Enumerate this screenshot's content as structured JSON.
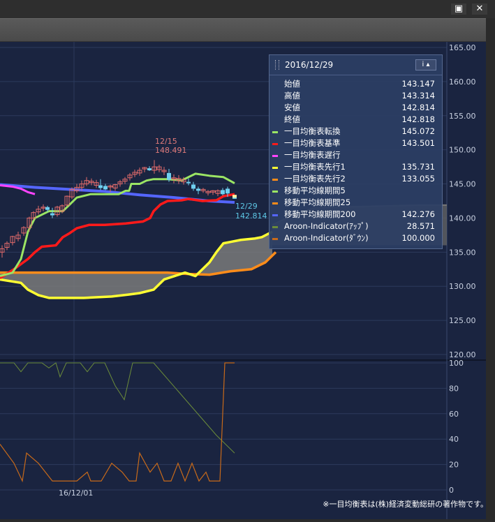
{
  "window": {
    "restore_label": "▣",
    "close_label": "✕"
  },
  "info_panel": {
    "date": "2016/12/29",
    "info_button_label": "i ▴",
    "rows": [
      {
        "label": "始値",
        "value": "143.147",
        "color": ""
      },
      {
        "label": "高値",
        "value": "143.314",
        "color": ""
      },
      {
        "label": "安値",
        "value": "142.814",
        "color": ""
      },
      {
        "label": "終値",
        "value": "142.818",
        "color": ""
      },
      {
        "label": "一目均衡表転換",
        "value": "145.072",
        "color": "#9be564"
      },
      {
        "label": "一目均衡表基準",
        "value": "143.501",
        "color": "#ff1a1a"
      },
      {
        "label": "一目均衡表遅行",
        "value": "",
        "color": "#ff44ff"
      },
      {
        "label": "一目均衡表先行1",
        "value": "135.731",
        "color": "#ffff33"
      },
      {
        "label": "一目均衡表先行2",
        "value": "133.055",
        "color": "#ff8c1a"
      },
      {
        "label": "移動平均線期間5",
        "value": "",
        "color": "#9be564"
      },
      {
        "label": "移動平均線期間25",
        "value": "",
        "color": "#ff8c1a"
      },
      {
        "label": "移動平均線期間200",
        "value": "142.276",
        "color": "#5566ff"
      },
      {
        "label": "Aroon-Indicator(ｱｯﾌﾟ)",
        "value": "28.571",
        "color": "#6b8c3a"
      },
      {
        "label": "Aroon-Indicator(ﾀﾞｳﾝ)",
        "value": "100.000",
        "color": "#c86a1a"
      }
    ]
  },
  "annotations": {
    "high_date": "12/15",
    "high_value": "148.491",
    "low_date": "12/29",
    "low_value": "142.814"
  },
  "copyright": "※一目均衡表は(株)経済変動総研の著作物です。",
  "chart_data": {
    "type": "line",
    "main": {
      "y_ticks": [
        "165.00",
        "160.00",
        "155.00",
        "150.00",
        "145.00",
        "140.00",
        "135.00",
        "130.00",
        "125.00",
        "120.00"
      ],
      "ylim": [
        120,
        165
      ]
    },
    "aroon": {
      "y_ticks": [
        "100",
        "80",
        "60",
        "40",
        "20",
        "0"
      ],
      "ylim": [
        0,
        100
      ],
      "x_label": "16/12/01"
    },
    "series": [
      {
        "name": "一目均衡表転換",
        "color": "#9be564",
        "width": 3,
        "values": [
          [
            0,
            131.5
          ],
          [
            18,
            132
          ],
          [
            30,
            134
          ],
          [
            40,
            138
          ],
          [
            50,
            140
          ],
          [
            60,
            140.5
          ],
          [
            70,
            141
          ],
          [
            90,
            141
          ],
          [
            100,
            142
          ],
          [
            110,
            143
          ],
          [
            130,
            143.5
          ],
          [
            150,
            143.5
          ],
          [
            170,
            143.5
          ],
          [
            180,
            144
          ],
          [
            185,
            144
          ],
          [
            188,
            145
          ],
          [
            200,
            145
          ],
          [
            210,
            145.5
          ],
          [
            220,
            145.7
          ],
          [
            240,
            145.7
          ],
          [
            260,
            145.5
          ],
          [
            270,
            146
          ],
          [
            280,
            146.5
          ],
          [
            300,
            146.2
          ],
          [
            320,
            146
          ],
          [
            336,
            145.1
          ]
        ]
      },
      {
        "name": "一目均衡表基準",
        "color": "#ff1a1a",
        "width": 3.5,
        "values": [
          [
            0,
            131.2
          ],
          [
            20,
            132.5
          ],
          [
            40,
            134
          ],
          [
            50,
            135
          ],
          [
            60,
            135.8
          ],
          [
            80,
            136
          ],
          [
            90,
            137.2
          ],
          [
            100,
            137.8
          ],
          [
            110,
            138.5
          ],
          [
            128,
            139
          ],
          [
            150,
            139
          ],
          [
            180,
            139.2
          ],
          [
            205,
            139.5
          ],
          [
            215,
            140
          ],
          [
            220,
            141
          ],
          [
            230,
            142
          ],
          [
            240,
            142.5
          ],
          [
            260,
            142.6
          ],
          [
            270,
            142.8
          ],
          [
            290,
            142.5
          ],
          [
            310,
            142.6
          ],
          [
            320,
            143.2
          ],
          [
            336,
            143.5
          ]
        ]
      },
      {
        "name": "一目均衡表遅行",
        "color": "#ff44ff",
        "width": 3,
        "values": [
          [
            0,
            144.8
          ],
          [
            18,
            144.6
          ],
          [
            30,
            144.3
          ],
          [
            40,
            143.8
          ],
          [
            50,
            143.5
          ]
        ]
      },
      {
        "name": "一目均衡表先行1",
        "color": "#ffff33",
        "width": 3.5,
        "values": [
          [
            0,
            131
          ],
          [
            30,
            130.5
          ],
          [
            40,
            129.5
          ],
          [
            55,
            128.7
          ],
          [
            70,
            128.3
          ],
          [
            90,
            128.3
          ],
          [
            120,
            128.3
          ],
          [
            160,
            128.5
          ],
          [
            185,
            128.8
          ],
          [
            200,
            129
          ],
          [
            220,
            129.5
          ],
          [
            235,
            131
          ],
          [
            250,
            131.5
          ],
          [
            265,
            132
          ],
          [
            280,
            131.5
          ],
          [
            300,
            133.5
          ],
          [
            310,
            135
          ],
          [
            320,
            136.3
          ],
          [
            330,
            136.5
          ],
          [
            345,
            136.8
          ],
          [
            365,
            137
          ],
          [
            375,
            137.2
          ],
          [
            390,
            138
          ]
        ]
      },
      {
        "name": "一目均衡表先行2",
        "color": "#ff8c1a",
        "width": 3.5,
        "values": [
          [
            0,
            132
          ],
          [
            60,
            132
          ],
          [
            100,
            132
          ],
          [
            150,
            132
          ],
          [
            200,
            132
          ],
          [
            240,
            132
          ],
          [
            270,
            131.8
          ],
          [
            300,
            131.7
          ],
          [
            330,
            132.2
          ],
          [
            360,
            132.5
          ],
          [
            380,
            133.5
          ],
          [
            395,
            135
          ]
        ]
      },
      {
        "name": "移動平均線期間200",
        "color": "#5566ff",
        "width": 4,
        "values": [
          [
            0,
            144.9
          ],
          [
            50,
            144.5
          ],
          [
            100,
            144.2
          ],
          [
            150,
            143.9
          ],
          [
            200,
            143.4
          ],
          [
            250,
            143
          ],
          [
            300,
            142.5
          ],
          [
            336,
            142.3
          ]
        ]
      }
    ],
    "cloud_right": [
      [
        390,
        139
      ],
      [
        420,
        140.5
      ],
      [
        450,
        141.5
      ],
      [
        480,
        141.6
      ],
      [
        520,
        141.7
      ],
      [
        560,
        141.8
      ],
      [
        600,
        141.9
      ],
      [
        640,
        141.9
      ]
    ],
    "candles": [
      [
        3,
        135.0,
        136.0,
        134.2,
        135.5
      ],
      [
        10,
        135.7,
        136.6,
        135.3,
        136.3
      ],
      [
        18,
        136.4,
        137.4,
        136.0,
        137.3
      ],
      [
        26,
        137.0,
        138.0,
        136.6,
        137.5
      ],
      [
        34,
        137.8,
        138.8,
        137.4,
        138.6
      ],
      [
        42,
        138.6,
        140.2,
        138.0,
        140.0
      ],
      [
        48,
        140.0,
        141.0,
        139.7,
        140.8
      ],
      [
        55,
        140.9,
        141.8,
        140.5,
        141.3
      ],
      [
        62,
        141.5,
        142.0,
        141.0,
        141.6
      ],
      [
        68,
        141.6,
        141.8,
        140.9,
        141.2
      ],
      [
        75,
        140.7,
        141.5,
        140.0,
        140.4
      ],
      [
        82,
        140.5,
        141.8,
        140.2,
        141.6
      ],
      [
        89,
        141.0,
        142.0,
        140.7,
        141.8
      ],
      [
        96,
        141.9,
        143.3,
        141.7,
        143.2
      ],
      [
        103,
        143.1,
        144.5,
        142.8,
        144.2
      ],
      [
        110,
        144.0,
        145.0,
        143.7,
        144.5
      ],
      [
        117,
        144.5,
        145.5,
        144.0,
        145.0
      ],
      [
        124,
        145.0,
        146.0,
        144.7,
        145.5
      ],
      [
        131,
        145.2,
        145.8,
        144.8,
        145.4
      ],
      [
        138,
        144.8,
        145.6,
        144.4,
        145.2
      ],
      [
        144,
        144.8,
        145.7,
        144.1,
        144.4
      ],
      [
        151,
        144.7,
        145.0,
        144.1,
        144.2
      ],
      [
        158,
        144.6,
        144.9,
        143.8,
        144.7
      ],
      [
        165,
        144.4,
        145.0,
        144.0,
        144.9
      ],
      [
        172,
        145.0,
        145.6,
        144.6,
        145.3
      ],
      [
        179,
        145.4,
        146.0,
        145.0,
        145.7
      ],
      [
        186,
        145.9,
        146.6,
        145.5,
        146.3
      ],
      [
        193,
        146.4,
        147.1,
        146.0,
        146.7
      ],
      [
        200,
        146.6,
        147.4,
        146.2,
        147.0
      ],
      [
        207,
        147.2,
        147.5,
        146.7,
        147.4
      ],
      [
        214,
        147.3,
        147.6,
        146.9,
        147.0
      ],
      [
        221,
        147.0,
        148.491,
        146.5,
        147.5
      ],
      [
        228,
        147.1,
        147.8,
        146.7,
        147.5
      ],
      [
        235,
        146.8,
        147.5,
        146.3,
        147.0
      ],
      [
        242,
        146.6,
        147.2,
        145.3,
        145.6
      ],
      [
        249,
        145.7,
        146.4,
        145.1,
        145.9
      ],
      [
        256,
        145.5,
        146.3,
        145.0,
        145.8
      ],
      [
        263,
        145.3,
        146.0,
        144.9,
        145.6
      ],
      [
        270,
        145.3,
        145.8,
        144.8,
        145.1
      ],
      [
        277,
        144.9,
        145.3,
        144.0,
        144.3
      ],
      [
        284,
        144.3,
        144.6,
        143.5,
        144.0
      ],
      [
        291,
        144.0,
        144.4,
        143.7,
        144.2
      ],
      [
        298,
        143.7,
        144.1,
        143.3,
        143.9
      ],
      [
        305,
        143.8,
        144.1,
        143.4,
        144.0
      ],
      [
        312,
        143.6,
        144.2,
        143.2,
        144.0
      ],
      [
        319,
        144.1,
        144.4,
        143.3,
        143.5
      ],
      [
        326,
        144.3,
        144.6,
        143.1,
        143.6
      ],
      [
        336,
        143.147,
        143.314,
        142.814,
        142.818
      ]
    ],
    "aroon_up": [
      [
        0,
        100
      ],
      [
        20,
        100
      ],
      [
        30,
        93
      ],
      [
        40,
        100
      ],
      [
        60,
        100
      ],
      [
        70,
        96
      ],
      [
        80,
        100
      ],
      [
        86,
        89
      ],
      [
        95,
        100
      ],
      [
        115,
        100
      ],
      [
        125,
        93
      ],
      [
        135,
        100
      ],
      [
        150,
        100
      ],
      [
        165,
        82
      ],
      [
        178,
        71
      ],
      [
        190,
        100
      ],
      [
        220,
        100
      ],
      [
        310,
        43
      ],
      [
        336,
        29
      ]
    ],
    "aroon_down": [
      [
        0,
        36
      ],
      [
        20,
        21
      ],
      [
        32,
        7
      ],
      [
        38,
        29
      ],
      [
        55,
        21
      ],
      [
        65,
        14
      ],
      [
        75,
        7
      ],
      [
        110,
        7
      ],
      [
        125,
        14
      ],
      [
        130,
        7
      ],
      [
        145,
        7
      ],
      [
        160,
        21
      ],
      [
        175,
        14
      ],
      [
        185,
        7
      ],
      [
        195,
        7
      ],
      [
        200,
        29
      ],
      [
        215,
        14
      ],
      [
        225,
        21
      ],
      [
        235,
        7
      ],
      [
        245,
        7
      ],
      [
        255,
        21
      ],
      [
        265,
        7
      ],
      [
        275,
        21
      ],
      [
        285,
        7
      ],
      [
        295,
        14
      ],
      [
        300,
        7
      ],
      [
        310,
        7
      ],
      [
        315,
        7
      ],
      [
        322,
        100
      ],
      [
        336,
        100
      ]
    ]
  }
}
